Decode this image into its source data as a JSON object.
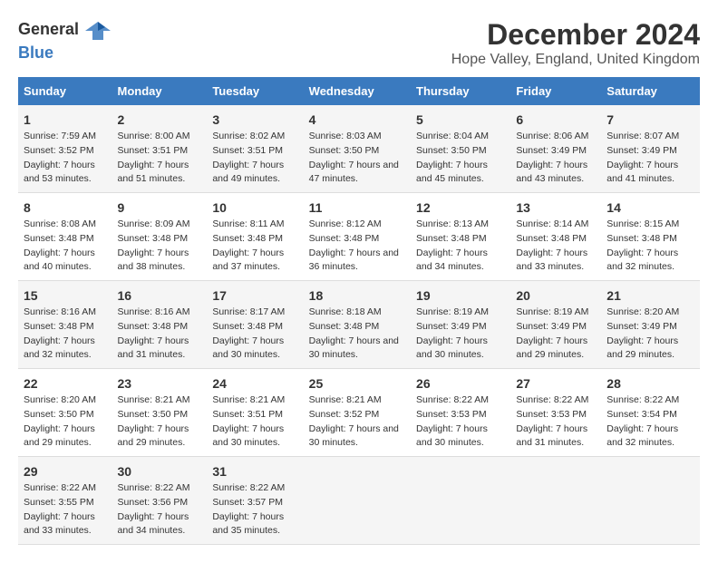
{
  "header": {
    "logo_general": "General",
    "logo_blue": "Blue",
    "title": "December 2024",
    "subtitle": "Hope Valley, England, United Kingdom"
  },
  "calendar": {
    "days_of_week": [
      "Sunday",
      "Monday",
      "Tuesday",
      "Wednesday",
      "Thursday",
      "Friday",
      "Saturday"
    ],
    "weeks": [
      [
        {
          "day": "1",
          "sunrise": "Sunrise: 7:59 AM",
          "sunset": "Sunset: 3:52 PM",
          "daylight": "Daylight: 7 hours and 53 minutes."
        },
        {
          "day": "2",
          "sunrise": "Sunrise: 8:00 AM",
          "sunset": "Sunset: 3:51 PM",
          "daylight": "Daylight: 7 hours and 51 minutes."
        },
        {
          "day": "3",
          "sunrise": "Sunrise: 8:02 AM",
          "sunset": "Sunset: 3:51 PM",
          "daylight": "Daylight: 7 hours and 49 minutes."
        },
        {
          "day": "4",
          "sunrise": "Sunrise: 8:03 AM",
          "sunset": "Sunset: 3:50 PM",
          "daylight": "Daylight: 7 hours and 47 minutes."
        },
        {
          "day": "5",
          "sunrise": "Sunrise: 8:04 AM",
          "sunset": "Sunset: 3:50 PM",
          "daylight": "Daylight: 7 hours and 45 minutes."
        },
        {
          "day": "6",
          "sunrise": "Sunrise: 8:06 AM",
          "sunset": "Sunset: 3:49 PM",
          "daylight": "Daylight: 7 hours and 43 minutes."
        },
        {
          "day": "7",
          "sunrise": "Sunrise: 8:07 AM",
          "sunset": "Sunset: 3:49 PM",
          "daylight": "Daylight: 7 hours and 41 minutes."
        }
      ],
      [
        {
          "day": "8",
          "sunrise": "Sunrise: 8:08 AM",
          "sunset": "Sunset: 3:48 PM",
          "daylight": "Daylight: 7 hours and 40 minutes."
        },
        {
          "day": "9",
          "sunrise": "Sunrise: 8:09 AM",
          "sunset": "Sunset: 3:48 PM",
          "daylight": "Daylight: 7 hours and 38 minutes."
        },
        {
          "day": "10",
          "sunrise": "Sunrise: 8:11 AM",
          "sunset": "Sunset: 3:48 PM",
          "daylight": "Daylight: 7 hours and 37 minutes."
        },
        {
          "day": "11",
          "sunrise": "Sunrise: 8:12 AM",
          "sunset": "Sunset: 3:48 PM",
          "daylight": "Daylight: 7 hours and 36 minutes."
        },
        {
          "day": "12",
          "sunrise": "Sunrise: 8:13 AM",
          "sunset": "Sunset: 3:48 PM",
          "daylight": "Daylight: 7 hours and 34 minutes."
        },
        {
          "day": "13",
          "sunrise": "Sunrise: 8:14 AM",
          "sunset": "Sunset: 3:48 PM",
          "daylight": "Daylight: 7 hours and 33 minutes."
        },
        {
          "day": "14",
          "sunrise": "Sunrise: 8:15 AM",
          "sunset": "Sunset: 3:48 PM",
          "daylight": "Daylight: 7 hours and 32 minutes."
        }
      ],
      [
        {
          "day": "15",
          "sunrise": "Sunrise: 8:16 AM",
          "sunset": "Sunset: 3:48 PM",
          "daylight": "Daylight: 7 hours and 32 minutes."
        },
        {
          "day": "16",
          "sunrise": "Sunrise: 8:16 AM",
          "sunset": "Sunset: 3:48 PM",
          "daylight": "Daylight: 7 hours and 31 minutes."
        },
        {
          "day": "17",
          "sunrise": "Sunrise: 8:17 AM",
          "sunset": "Sunset: 3:48 PM",
          "daylight": "Daylight: 7 hours and 30 minutes."
        },
        {
          "day": "18",
          "sunrise": "Sunrise: 8:18 AM",
          "sunset": "Sunset: 3:48 PM",
          "daylight": "Daylight: 7 hours and 30 minutes."
        },
        {
          "day": "19",
          "sunrise": "Sunrise: 8:19 AM",
          "sunset": "Sunset: 3:49 PM",
          "daylight": "Daylight: 7 hours and 30 minutes."
        },
        {
          "day": "20",
          "sunrise": "Sunrise: 8:19 AM",
          "sunset": "Sunset: 3:49 PM",
          "daylight": "Daylight: 7 hours and 29 minutes."
        },
        {
          "day": "21",
          "sunrise": "Sunrise: 8:20 AM",
          "sunset": "Sunset: 3:49 PM",
          "daylight": "Daylight: 7 hours and 29 minutes."
        }
      ],
      [
        {
          "day": "22",
          "sunrise": "Sunrise: 8:20 AM",
          "sunset": "Sunset: 3:50 PM",
          "daylight": "Daylight: 7 hours and 29 minutes."
        },
        {
          "day": "23",
          "sunrise": "Sunrise: 8:21 AM",
          "sunset": "Sunset: 3:50 PM",
          "daylight": "Daylight: 7 hours and 29 minutes."
        },
        {
          "day": "24",
          "sunrise": "Sunrise: 8:21 AM",
          "sunset": "Sunset: 3:51 PM",
          "daylight": "Daylight: 7 hours and 30 minutes."
        },
        {
          "day": "25",
          "sunrise": "Sunrise: 8:21 AM",
          "sunset": "Sunset: 3:52 PM",
          "daylight": "Daylight: 7 hours and 30 minutes."
        },
        {
          "day": "26",
          "sunrise": "Sunrise: 8:22 AM",
          "sunset": "Sunset: 3:53 PM",
          "daylight": "Daylight: 7 hours and 30 minutes."
        },
        {
          "day": "27",
          "sunrise": "Sunrise: 8:22 AM",
          "sunset": "Sunset: 3:53 PM",
          "daylight": "Daylight: 7 hours and 31 minutes."
        },
        {
          "day": "28",
          "sunrise": "Sunrise: 8:22 AM",
          "sunset": "Sunset: 3:54 PM",
          "daylight": "Daylight: 7 hours and 32 minutes."
        }
      ],
      [
        {
          "day": "29",
          "sunrise": "Sunrise: 8:22 AM",
          "sunset": "Sunset: 3:55 PM",
          "daylight": "Daylight: 7 hours and 33 minutes."
        },
        {
          "day": "30",
          "sunrise": "Sunrise: 8:22 AM",
          "sunset": "Sunset: 3:56 PM",
          "daylight": "Daylight: 7 hours and 34 minutes."
        },
        {
          "day": "31",
          "sunrise": "Sunrise: 8:22 AM",
          "sunset": "Sunset: 3:57 PM",
          "daylight": "Daylight: 7 hours and 35 minutes."
        },
        {
          "day": "",
          "sunrise": "",
          "sunset": "",
          "daylight": ""
        },
        {
          "day": "",
          "sunrise": "",
          "sunset": "",
          "daylight": ""
        },
        {
          "day": "",
          "sunrise": "",
          "sunset": "",
          "daylight": ""
        },
        {
          "day": "",
          "sunrise": "",
          "sunset": "",
          "daylight": ""
        }
      ]
    ]
  }
}
